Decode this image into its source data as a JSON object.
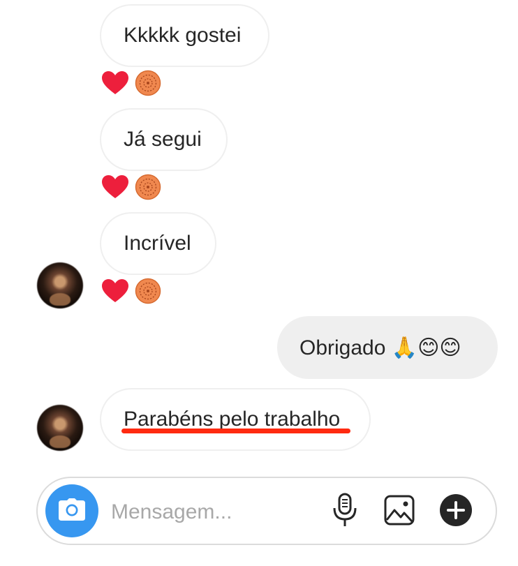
{
  "messages": [
    {
      "text": "Kkkkk gostei",
      "direction": "incoming",
      "reactions": [
        "heart-icon",
        "donut-emoji-icon"
      ]
    },
    {
      "text": "Já segui",
      "direction": "incoming",
      "reactions": [
        "heart-icon",
        "donut-emoji-icon"
      ]
    },
    {
      "text": "Incrível",
      "direction": "incoming",
      "reactions": [
        "heart-icon",
        "donut-emoji-icon"
      ]
    },
    {
      "text": "Obrigado 🙏😊😊",
      "direction": "outgoing"
    },
    {
      "text": "Parabéns pelo trabalho",
      "direction": "incoming",
      "highlighted": true
    }
  ],
  "composer": {
    "placeholder": "Mensagem...",
    "icons": [
      "camera-icon",
      "microphone-icon",
      "gallery-icon",
      "plus-icon"
    ]
  },
  "colors": {
    "accent": "#3797f0",
    "heart": "#ed1f3c",
    "highlight_underline": "#ff2a10",
    "outgoing_bubble": "#efefef",
    "placeholder": "#a8a8a8"
  }
}
